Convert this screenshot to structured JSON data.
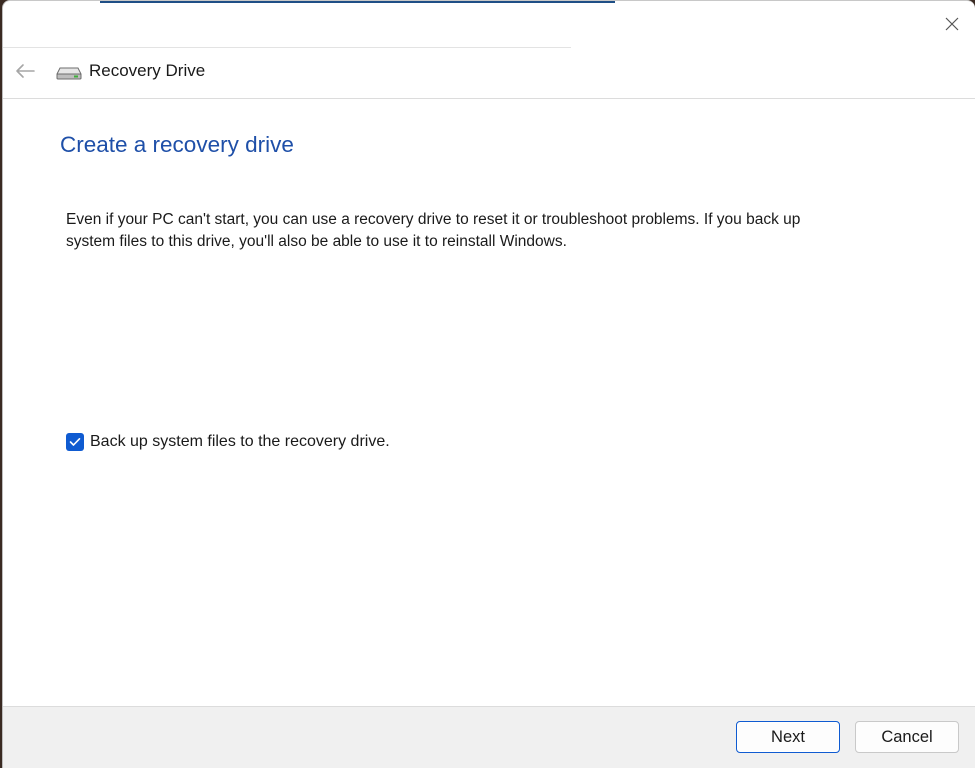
{
  "window": {
    "title": "Recovery Drive"
  },
  "icons": {
    "close": "close-icon",
    "back": "back-arrow-icon",
    "drive": "drive-icon",
    "check": "checkmark-icon"
  },
  "colors": {
    "accent": "#0f5bd1",
    "heading": "#1e4fa8"
  },
  "page": {
    "heading": "Create a recovery drive",
    "description": "Even if your PC can't start, you can use a recovery drive to reset it or troubleshoot problems. If you back up system files to this drive, you'll also be able to use it to reinstall Windows.",
    "checkbox": {
      "label": "Back up system files to the recovery drive.",
      "checked": true
    }
  },
  "footer": {
    "next_label": "Next",
    "cancel_label": "Cancel"
  }
}
